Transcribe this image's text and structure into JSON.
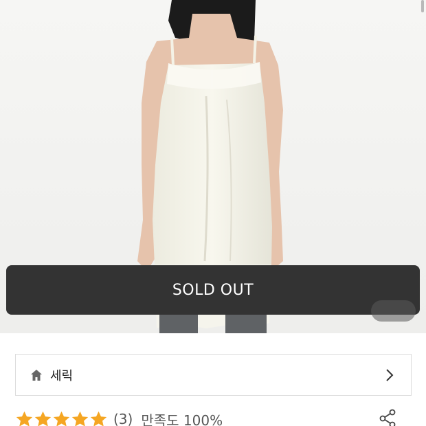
{
  "product": {
    "status_label": "SOLD OUT"
  },
  "brand": {
    "name": "세릭",
    "icon": "home-icon",
    "chevron": "chevron-right-icon"
  },
  "rating": {
    "stars": 5,
    "max_stars": 5,
    "count_text": "(3)",
    "satisfaction_text": "만족도 100%",
    "share_icon": "share-icon"
  },
  "colors": {
    "soldout_bg": "#333333",
    "star": "#f5a623",
    "background": "#f4f4f2"
  }
}
